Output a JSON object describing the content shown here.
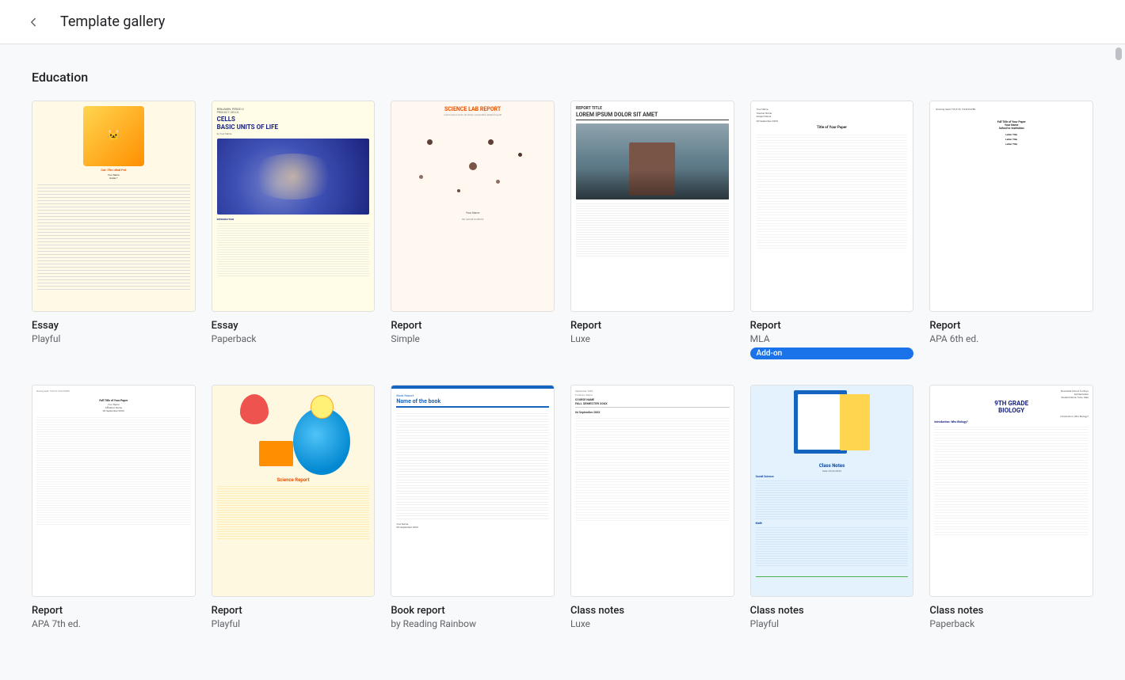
{
  "header": {
    "back_label": "←",
    "title": "Template gallery"
  },
  "sections": [
    {
      "id": "education",
      "label": "Education",
      "rows": [
        [
          {
            "id": "essay-playful",
            "name": "Essay",
            "sub": "Playful",
            "badge": null,
            "thumb_type": "essay-playful"
          },
          {
            "id": "essay-paperback",
            "name": "Essay",
            "sub": "Paperback",
            "badge": null,
            "thumb_type": "essay-paperback"
          },
          {
            "id": "report-simple",
            "name": "Report",
            "sub": "Simple",
            "badge": null,
            "thumb_type": "report-simple"
          },
          {
            "id": "report-luxe",
            "name": "Report",
            "sub": "Luxe",
            "badge": null,
            "thumb_type": "report-luxe"
          },
          {
            "id": "report-mla",
            "name": "Report",
            "sub": "MLA",
            "badge": "Add-on",
            "thumb_type": "report-mla"
          },
          {
            "id": "report-apa6",
            "name": "Report",
            "sub": "APA 6th ed.",
            "badge": null,
            "thumb_type": "report-apa6"
          }
        ],
        [
          {
            "id": "report-apa7",
            "name": "Report",
            "sub": "APA 7th ed.",
            "badge": null,
            "thumb_type": "report-apa7"
          },
          {
            "id": "report-playful",
            "name": "Report",
            "sub": "Playful",
            "badge": null,
            "thumb_type": "report-playful"
          },
          {
            "id": "book-report",
            "name": "Book report",
            "sub": "by Reading Rainbow",
            "badge": null,
            "thumb_type": "book-report"
          },
          {
            "id": "classnotes-luxe",
            "name": "Class notes",
            "sub": "Luxe",
            "badge": null,
            "thumb_type": "classnotes-luxe"
          },
          {
            "id": "classnotes-playful",
            "name": "Class notes",
            "sub": "Playful",
            "badge": null,
            "thumb_type": "classnotes-playful"
          },
          {
            "id": "classnotes-paperback",
            "name": "Class notes",
            "sub": "Paperback",
            "badge": null,
            "thumb_type": "classnotes-paperback"
          }
        ]
      ]
    }
  ],
  "badges": {
    "add_on": "Add-on"
  }
}
